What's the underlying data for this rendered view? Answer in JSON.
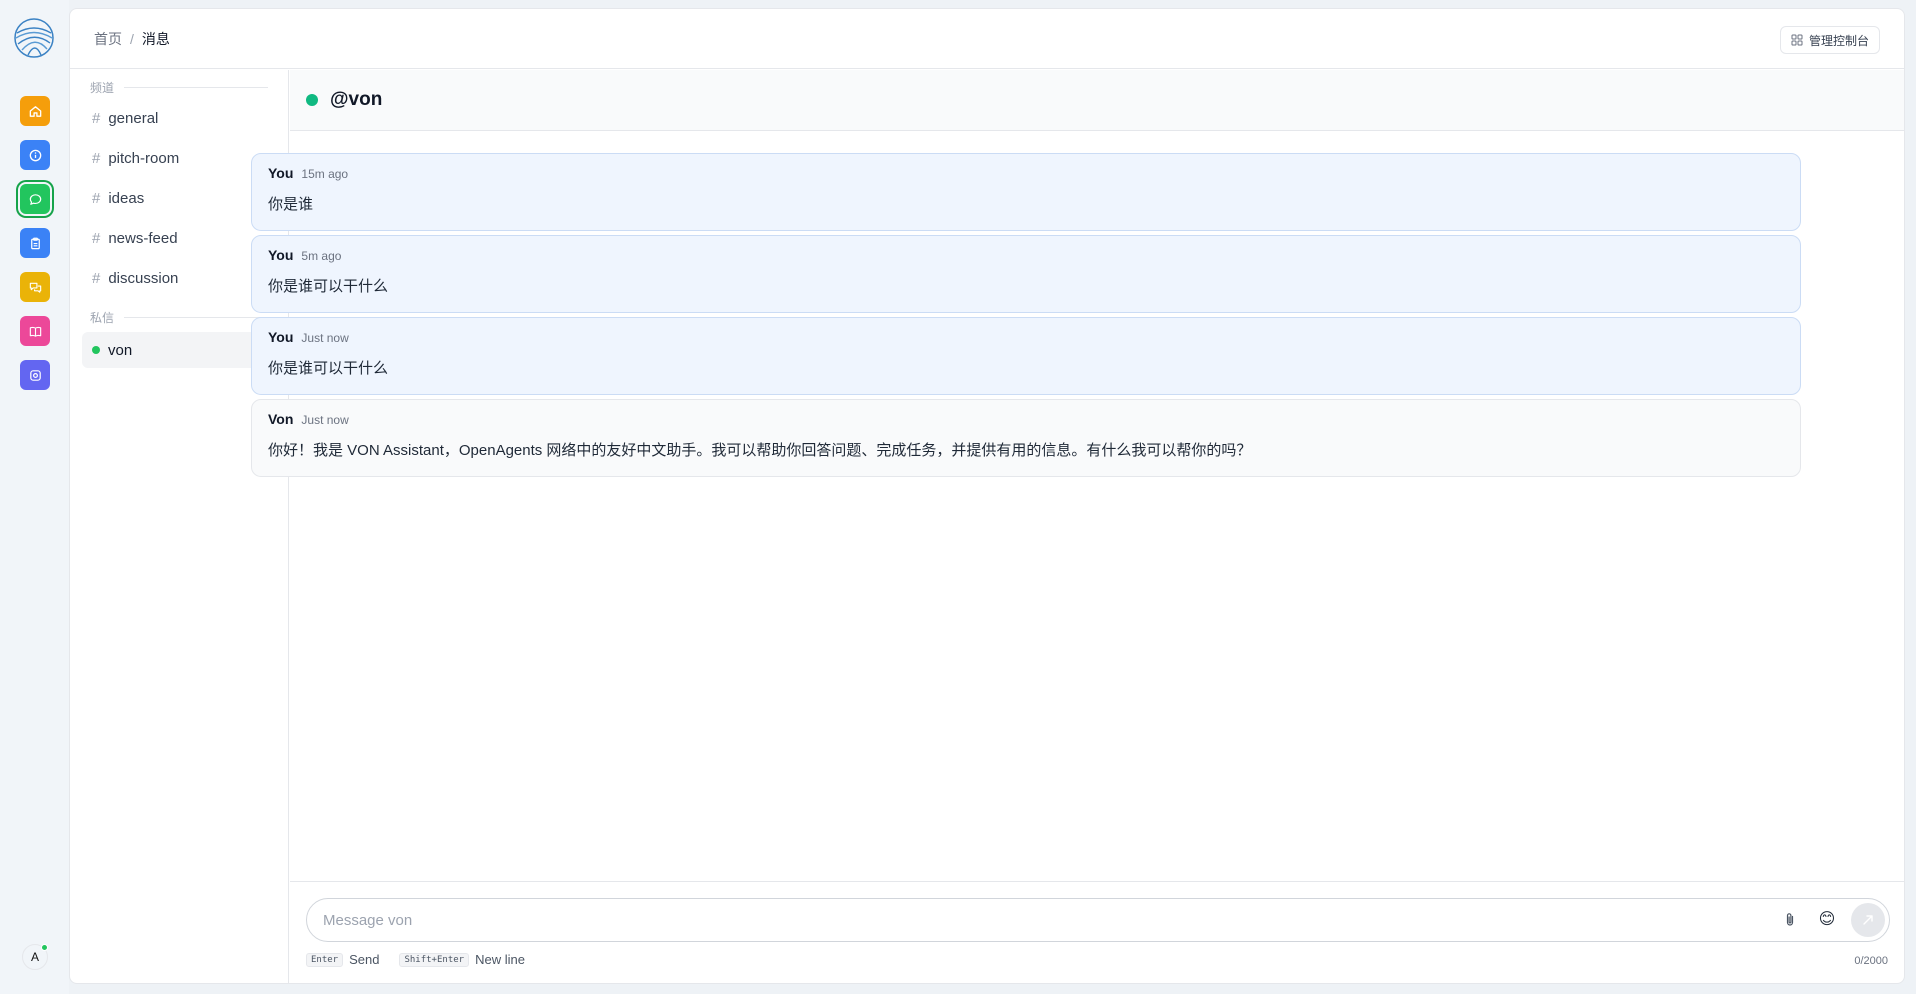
{
  "breadcrumb": {
    "home": "首页",
    "separator": "/",
    "current": "消息"
  },
  "header": {
    "admin_label": "管理控制台"
  },
  "rail": {
    "items": [
      {
        "name": "home-icon",
        "color": "#f59e0b"
      },
      {
        "name": "info-icon",
        "color": "#3b82f6"
      },
      {
        "name": "chat-icon",
        "color": "#22c55e",
        "active": true
      },
      {
        "name": "clipboard-icon",
        "color": "#3b82f6"
      },
      {
        "name": "comments-icon",
        "color": "#eab308"
      },
      {
        "name": "book-icon",
        "color": "#ec4899"
      },
      {
        "name": "settings-icon",
        "color": "#6366f1"
      }
    ],
    "avatar_initial": "A"
  },
  "sidebar": {
    "channels_title": "频道",
    "channels": [
      "general",
      "pitch-room",
      "ideas",
      "news-feed",
      "discussion"
    ],
    "dm_title": "私信",
    "dms": [
      {
        "name": "von",
        "online": true
      }
    ]
  },
  "chat": {
    "title": "@von",
    "messages": [
      {
        "author": "You",
        "time": "15m ago",
        "text": "你是谁"
      },
      {
        "author": "You",
        "time": "5m ago",
        "text": "你是谁可以干什么"
      },
      {
        "author": "You",
        "time": "Just now",
        "text": "你是谁可以干什么"
      },
      {
        "author": "Von",
        "time": "Just now",
        "text": "你好！我是 VON Assistant，OpenAgents 网络中的友好中文助手。我可以帮助你回答问题、完成任务，并提供有用的信息。有什么我可以帮你的吗？"
      }
    ]
  },
  "composer": {
    "placeholder": "Message von",
    "hint_enter_key": "Enter",
    "hint_enter_label": "Send",
    "hint_shift_key": "Shift+Enter",
    "hint_shift_label": "New line",
    "counter": "0/2000"
  }
}
